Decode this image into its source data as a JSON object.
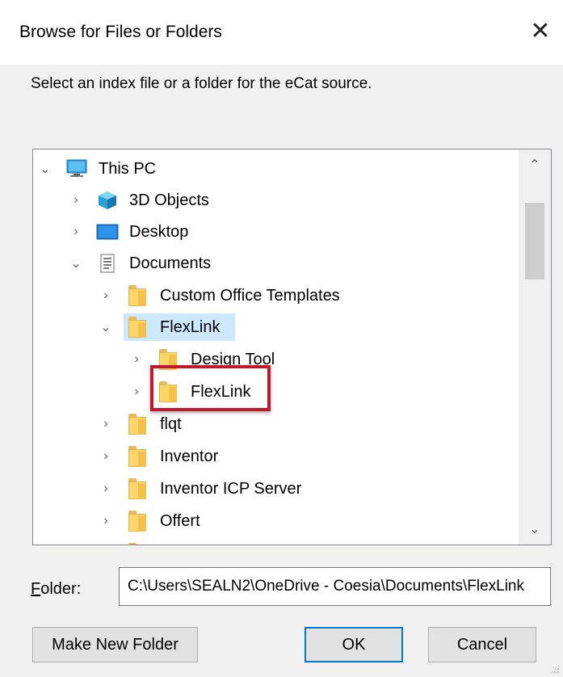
{
  "dialog": {
    "title": "Browse for Files or Folders",
    "close_label": "✕",
    "instructions": "Select an index file or a folder for the eCat source."
  },
  "tree": {
    "items": [
      {
        "label": "This PC",
        "icon": "computer-icon",
        "expander": "expanded"
      },
      {
        "label": "3D Objects",
        "icon": "3d-objects-icon",
        "expander": "collapsed"
      },
      {
        "label": "Desktop",
        "icon": "desktop-icon",
        "expander": "collapsed"
      },
      {
        "label": "Documents",
        "icon": "documents-icon",
        "expander": "expanded"
      },
      {
        "label": "Custom Office Templates",
        "icon": "folder-icon",
        "expander": "collapsed"
      },
      {
        "label": "FlexLink",
        "icon": "folder-icon",
        "expander": "expanded",
        "selected": true
      },
      {
        "label": "Design Tool",
        "icon": "folder-icon",
        "expander": "collapsed"
      },
      {
        "label": "FlexLink",
        "icon": "folder-icon",
        "expander": "collapsed",
        "annotated": true
      },
      {
        "label": "flqt",
        "icon": "folder-icon",
        "expander": "collapsed"
      },
      {
        "label": "Inventor",
        "icon": "folder-icon",
        "expander": "collapsed"
      },
      {
        "label": "Inventor ICP Server",
        "icon": "folder-icon",
        "expander": "collapsed"
      },
      {
        "label": "Offert",
        "icon": "folder-icon",
        "expander": "collapsed"
      }
    ]
  },
  "folder_field": {
    "label_accel": "F",
    "label_rest": "older:",
    "value": "C:\\Users\\SEALN2\\OneDrive - Coesia\\Documents\\FlexLink"
  },
  "buttons": {
    "make_new_folder": "Make New Folder",
    "ok": "OK",
    "cancel": "Cancel"
  },
  "colors": {
    "selection": "#cce8ff",
    "annotation": "#c0192e",
    "default_button_border": "#0078d7"
  }
}
